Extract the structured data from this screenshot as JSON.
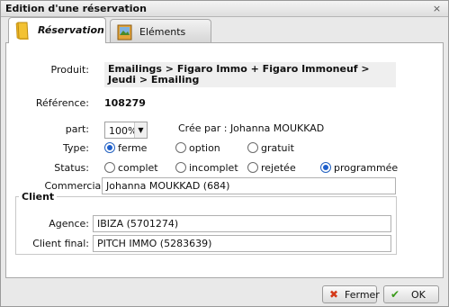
{
  "window": {
    "title": "Edition d'une réservation",
    "close_glyph": "×"
  },
  "tabs": [
    {
      "label": "Réservation",
      "icon": "book-icon",
      "active": true
    },
    {
      "label": "Eléments",
      "icon": "photo-icon",
      "active": false
    }
  ],
  "form": {
    "produit_label": "Produit:",
    "produit_value": "Emailings > Figaro Immo + Figaro Immoneuf > Jeudi > Emailing",
    "reference_label": "Référence:",
    "reference_value": "108279",
    "part_label": "part:",
    "part_value": "100%",
    "cree_par": "Crée par : Johanna MOUKKAD",
    "type_label": "Type:",
    "type_options": [
      "ferme",
      "option",
      "gratuit"
    ],
    "type_selected": "ferme",
    "status_label": "Status:",
    "status_options": [
      "complet",
      "incomplet",
      "rejetée",
      "programmée"
    ],
    "status_selected": "programmée",
    "commercial_label": "Commercial:",
    "commercial_value": "Johanna MOUKKAD (684)"
  },
  "client": {
    "legend": "Client",
    "agence_label": "Agence:",
    "agence_value": "IBIZA (5701274)",
    "client_final_label": "Client final:",
    "client_final_value": "PITCH IMMO (5283639)"
  },
  "buttons": {
    "close_label": "Fermer",
    "ok_label": "OK",
    "close_icon": "x-icon",
    "ok_icon": "check-icon"
  },
  "colors": {
    "radio_selected": "#1d5fcc",
    "ok_check": "#3a9a1a",
    "close_x": "#d43a1a"
  }
}
